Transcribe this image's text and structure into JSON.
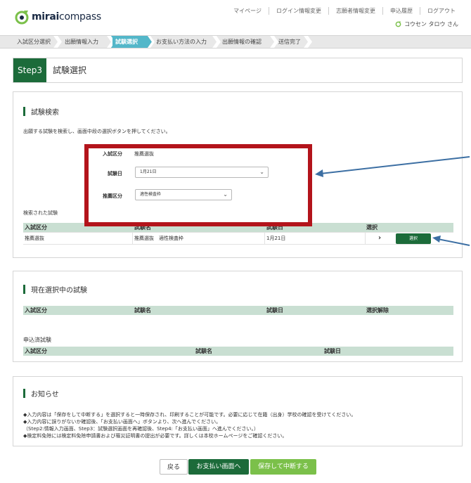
{
  "header": {
    "logo_part1": "mirai",
    "logo_part2": "compass",
    "nav": [
      "マイページ",
      "ログイン情報変更",
      "志願者情報変更",
      "申込履歴",
      "ログアウト"
    ],
    "user_name": "コウセン タロウ さん"
  },
  "steps": [
    "入試区分選択",
    "出願情報入力",
    "試験選択",
    "お支払い方法の入力",
    "出願情報の確認",
    "送信完了"
  ],
  "panel": {
    "step_badge": "Step3",
    "title": "試験選択"
  },
  "search": {
    "title": "試験検索",
    "description": "出願する試験を検索し、画面中段の選択ボタンを押してください。",
    "exam_type_label": "入試区分",
    "exam_type_value": "推薦選抜",
    "exam_date_label": "試験日",
    "exam_date_value": "1月21日",
    "recommend_label": "推薦区分",
    "recommend_value": "適性検査枠",
    "results_label": "検索された試験",
    "columns": [
      "入試区分",
      "試験名",
      "試験日",
      "選択"
    ],
    "rows": [
      {
        "type": "推薦選抜",
        "name": "推薦選抜　適性検査枠",
        "date": "1月21日",
        "button": "選択"
      }
    ]
  },
  "selected": {
    "title": "現在選択中の試験",
    "columns": [
      "入試区分",
      "試験名",
      "試験日",
      "選択解除"
    ],
    "applied_label": "申込済試験",
    "applied_columns": [
      "入試区分",
      "試験名",
      "試験日"
    ]
  },
  "notice": {
    "title": "お知らせ",
    "lines": [
      "◆入力内容は「保存をして中断する」を選択すると一時保存され、印刷することが可能です。必要に応じて在籍（出身）学校の確認を受けてください。",
      "◆入力内容に誤りがないか確認後、「お支払い画面へ」ボタンより、次へ進んでください。",
      "（Step2:情報入力画面、Step3：試験選択画面を再確認後、Step4:「お支払い画面」へ進んでください。）",
      "◆検定料免除には検定料免除申請書および罹災証明書の提出が必要です。詳しくは本校ホームページをご確認ください。"
    ]
  },
  "buttons": {
    "back": "戻る",
    "pay": "お支払い画面へ",
    "save": "保存して中断する"
  },
  "colors": {
    "brand_green": "#1c6b3a",
    "step_active": "#53b7c9",
    "save_green": "#7bc04a",
    "annotation_red": "#b3141b",
    "annotation_arrow": "#3c6fa3"
  }
}
